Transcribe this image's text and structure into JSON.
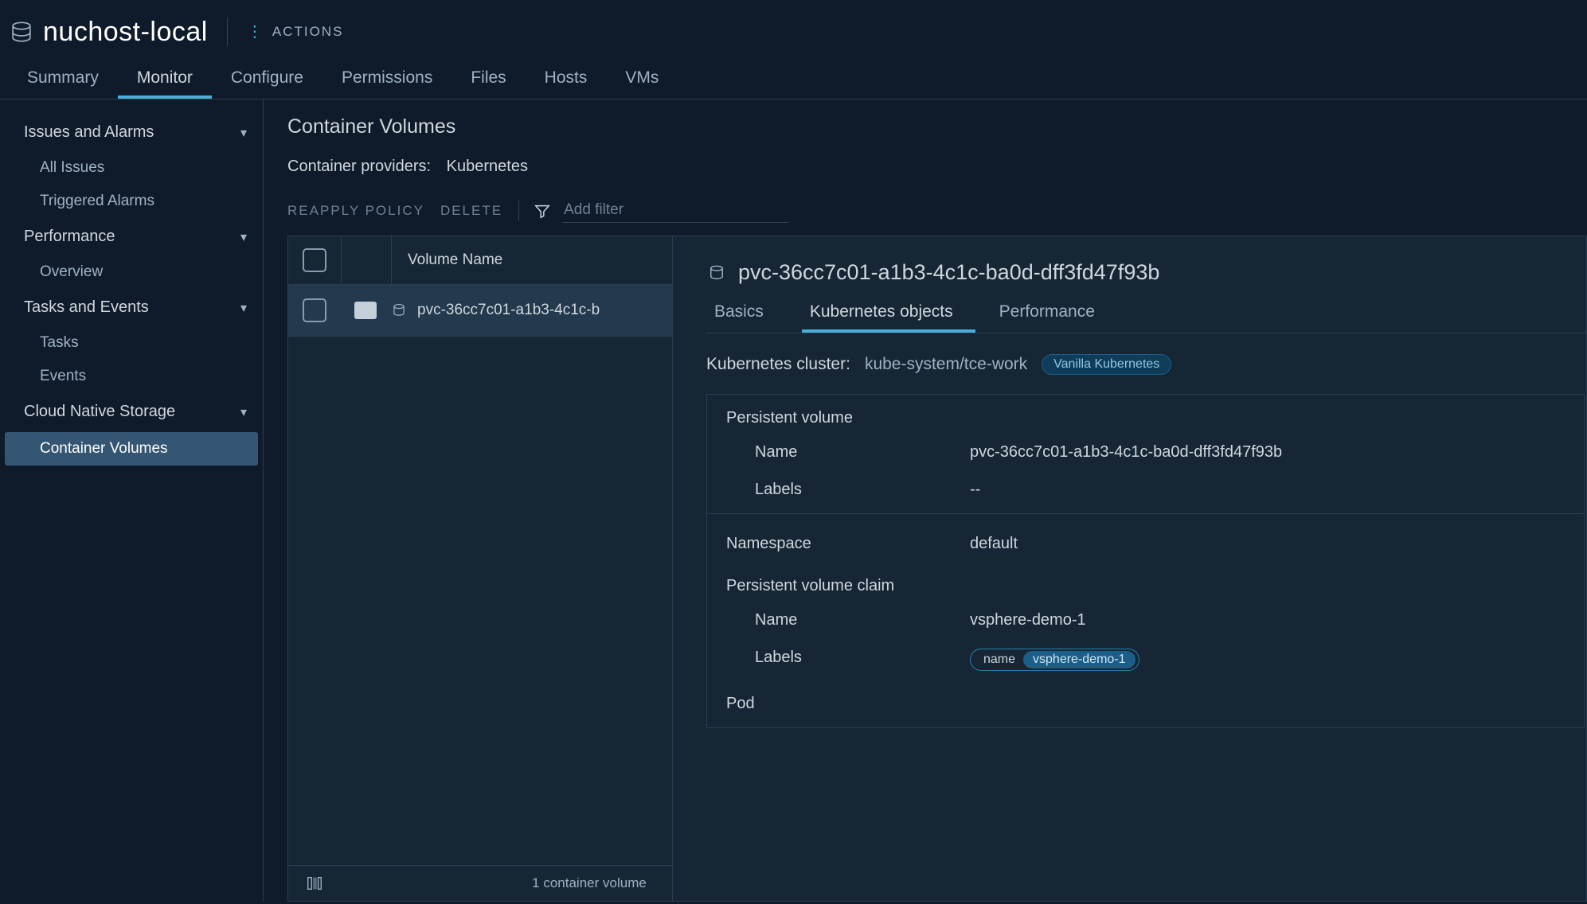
{
  "header": {
    "title": "nuchost-local",
    "actions_label": "ACTIONS"
  },
  "tabs": [
    "Summary",
    "Monitor",
    "Configure",
    "Permissions",
    "Files",
    "Hosts",
    "VMs"
  ],
  "active_tab": "Monitor",
  "sidebar": {
    "groups": [
      {
        "label": "Issues and Alarms",
        "children": [
          "All Issues",
          "Triggered Alarms"
        ]
      },
      {
        "label": "Performance",
        "children": [
          "Overview"
        ]
      },
      {
        "label": "Tasks and Events",
        "children": [
          "Tasks",
          "Events"
        ]
      },
      {
        "label": "Cloud Native Storage",
        "children": [
          "Container Volumes"
        ]
      }
    ],
    "active_child": "Container Volumes"
  },
  "main": {
    "heading": "Container Volumes",
    "provider_label": "Container providers:",
    "provider_value": "Kubernetes",
    "reapply_label": "REAPPLY POLICY",
    "delete_label": "DELETE",
    "filter_placeholder": "Add filter",
    "column_header": "Volume Name",
    "row_name": "pvc-36cc7c01-a1b3-4c1c-b",
    "footer_count": "1 container volume"
  },
  "detail": {
    "title": "pvc-36cc7c01-a1b3-4c1c-ba0d-dff3fd47f93b",
    "subtabs": [
      "Basics",
      "Kubernetes objects",
      "Performance"
    ],
    "active_subtab": "Kubernetes objects",
    "cluster_label": "Kubernetes cluster:",
    "cluster_value": "kube-system/tce-work",
    "cluster_badge": "Vanilla Kubernetes",
    "pv_section": "Persistent volume",
    "name_label": "Name",
    "labels_label": "Labels",
    "pv_name": "pvc-36cc7c01-a1b3-4c1c-ba0d-dff3fd47f93b",
    "pv_labels": "--",
    "ns_label": "Namespace",
    "ns_value": "default",
    "pvc_section": "Persistent volume claim",
    "pvc_name": "vsphere-demo-1",
    "pvc_label_key": "name",
    "pvc_label_val": "vsphere-demo-1",
    "pod_section": "Pod"
  }
}
